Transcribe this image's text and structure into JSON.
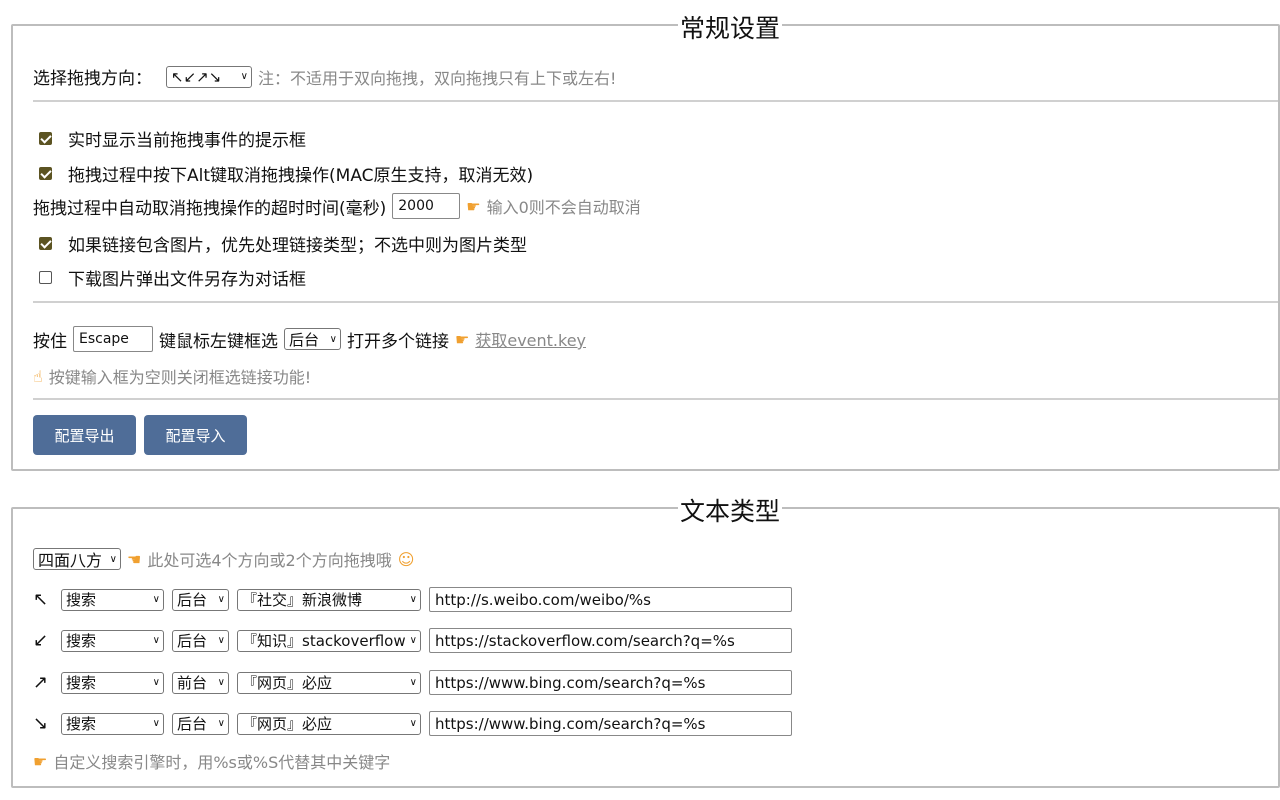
{
  "general": {
    "title": "常规设置",
    "direction_label": "选择拖拽方向：",
    "direction_value": "↖↙↗↘",
    "direction_note": "注：不适用于双向拖拽，双向拖拽只有上下或左右!",
    "show_tip": {
      "label": "实时显示当前拖拽事件的提示框",
      "checked": true
    },
    "alt_cancel": {
      "label": "拖拽过程中按下Alt键取消拖拽操作(MAC原生支持，取消无效)",
      "checked": true
    },
    "timeout_label": "拖拽过程中自动取消拖拽操作的超时时间(毫秒)",
    "timeout_value": "2000",
    "timeout_hint": "输入0则不会自动取消",
    "prefer_link": {
      "label": "如果链接包含图片，优先处理链接类型；不选中则为图片类型",
      "checked": true
    },
    "save_dialog": {
      "label": "下载图片弹出文件另存为对话框",
      "checked": false
    },
    "hold_label": "按住",
    "hold_key": "Escape",
    "select_label": "键鼠标左键框选",
    "open_mode": "后台",
    "open_label": "打开多个链接",
    "get_key_link": "获取event.key",
    "key_hint": "按键输入框为空则关闭框选链接功能!",
    "export_button": "配置导出",
    "import_button": "配置导入"
  },
  "text": {
    "title": "文本类型",
    "mode": "四面八方",
    "mode_hint": "此处可选4个方向或2个方向拖拽哦",
    "rows": [
      {
        "arrow": "↖",
        "action": "搜索",
        "tab": "后台",
        "engine": "『社交』新浪微博",
        "url": "http://s.weibo.com/weibo/%s"
      },
      {
        "arrow": "↙",
        "action": "搜索",
        "tab": "后台",
        "engine": "『知识』stackoverflow",
        "url": "https://stackoverflow.com/search?q=%s"
      },
      {
        "arrow": "↗",
        "action": "搜索",
        "tab": "前台",
        "engine": "『网页』必应",
        "url": "https://www.bing.com/search?q=%s"
      },
      {
        "arrow": "↘",
        "action": "搜索",
        "tab": "后台",
        "engine": "『网页』必应",
        "url": "https://www.bing.com/search?q=%s"
      }
    ],
    "footer_hint": "自定义搜索引擎时，用%s或%S代替其中关键字"
  }
}
